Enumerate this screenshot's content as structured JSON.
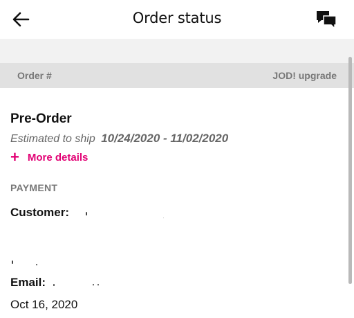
{
  "header": {
    "title": "Order status",
    "back_icon": "arrow-left-icon",
    "chat_icon": "chat-bubbles-icon"
  },
  "order_bar": {
    "order_label": "Order #",
    "upgrade_label": "JOD! upgrade"
  },
  "order": {
    "status": "Pre-Order",
    "ship_label": "Estimated to ship",
    "ship_dates": "10/24/2020 - 11/02/2020",
    "more_details_icon": "+",
    "more_details_label": "More details"
  },
  "payment": {
    "heading": "PAYMENT",
    "customer_label": "Customer:",
    "email_label": "Email:",
    "date": "Oct 16, 2020"
  },
  "colors": {
    "accent": "#e20074",
    "muted_text": "#777777",
    "order_bar_bg": "#e1e1e1",
    "strip_bg": "#f2f2f2"
  }
}
